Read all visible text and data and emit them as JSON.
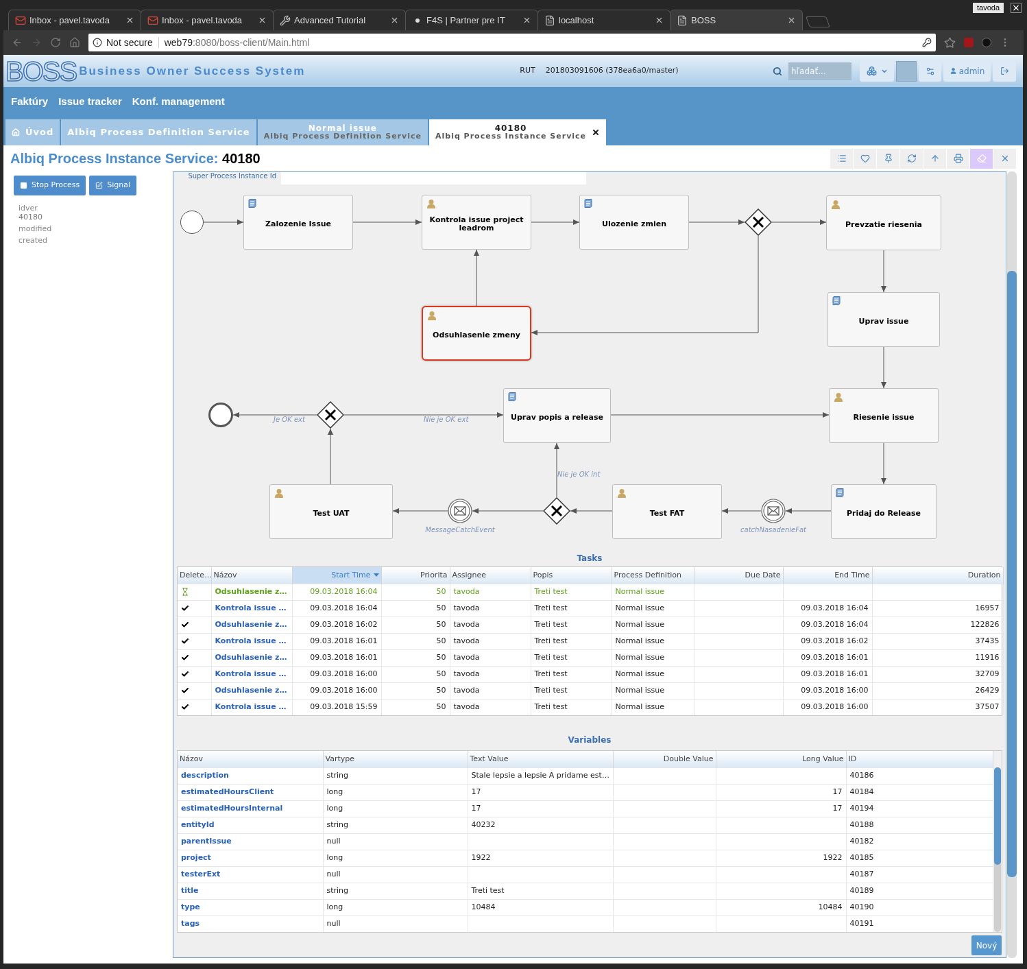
{
  "browser": {
    "tabs": [
      {
        "title": "Inbox - pavel.tavoda",
        "kind": "mail",
        "selected": false
      },
      {
        "title": "Inbox - pavel.tavoda",
        "kind": "mail",
        "selected": false
      },
      {
        "title": "Advanced Tutorial",
        "kind": "tool",
        "selected": false
      },
      {
        "title": "F4S | Partner pre IT",
        "kind": "dot",
        "selected": false
      },
      {
        "title": "localhost",
        "kind": "page",
        "selected": false
      },
      {
        "title": "BOSS",
        "kind": "page",
        "selected": true
      }
    ],
    "profile": "tavoda",
    "security": "Not secure",
    "url_host": "web79",
    "url_rest": ":8080/boss-client/Main.html"
  },
  "app": {
    "logo": "BOSS",
    "system_name": "Business Owner Success System",
    "env": "RUT",
    "build": "201803091606 (378ea6a0/master)",
    "search_placeholder": "hľadať...",
    "user": "admin"
  },
  "menu": [
    "Faktúry",
    "Issue tracker",
    "Konf. management"
  ],
  "tabs": [
    {
      "title": "Úvod",
      "kind": "home",
      "selected": false,
      "closable": false
    },
    {
      "title": "Albiq Process Definition Service",
      "selected": false,
      "closable": false
    },
    {
      "title": "Normal issue",
      "subtitle": "Albiq Process Definition Service",
      "selected": false,
      "closable": false
    },
    {
      "title": "40180",
      "subtitle": "Albiq Process Instance Service",
      "selected": true,
      "closable": true
    }
  ],
  "page": {
    "title": "Albiq Process Instance Service:",
    "id": "40180"
  },
  "toolbar": [
    {
      "kind": "list",
      "selected": false
    },
    {
      "kind": "favorite",
      "selected": false
    },
    {
      "kind": "pin",
      "selected": false
    },
    {
      "kind": "refresh",
      "selected": false
    },
    {
      "kind": "up",
      "selected": false
    },
    {
      "kind": "print",
      "selected": false
    },
    {
      "kind": "eraser",
      "selected": true
    },
    {
      "kind": "close",
      "selected": false
    }
  ],
  "actions": [
    {
      "label": "Stop Process",
      "kind": "stop"
    },
    {
      "label": "Signal",
      "kind": "signal"
    }
  ],
  "properties": [
    {
      "label": "idver",
      "value": "40180"
    },
    {
      "label": "modified"
    },
    {
      "label": "created"
    }
  ],
  "diagram": {
    "super_label": "Super Process Instance Id",
    "nodes": [
      {
        "kind": "start"
      },
      {
        "kind": "script_task",
        "label": "Zalozenie Issue",
        "active": false
      },
      {
        "kind": "user_task",
        "label": "Kontrola issue project leadrom",
        "active": false
      },
      {
        "kind": "script_task",
        "label": "Ulozenie zmien",
        "active": false
      },
      {
        "kind": "gateway"
      },
      {
        "kind": "user_task",
        "label": "Prevzatie riesenia",
        "active": false
      },
      {
        "kind": "user_task",
        "label": "Odsuhlasenie zmeny",
        "active": true
      },
      {
        "kind": "script_task",
        "label": "Uprav issue",
        "active": false
      },
      {
        "kind": "user_task",
        "label": "Riesenie issue",
        "active": false
      },
      {
        "kind": "script_task",
        "label": "Uprav popis a release",
        "active": false
      },
      {
        "kind": "gateway"
      },
      {
        "kind": "end"
      },
      {
        "kind": "script_task",
        "label": "Pridaj do Release",
        "active": false
      },
      {
        "kind": "message_event",
        "label": "catchNasadenieFat"
      },
      {
        "kind": "user_task",
        "label": "Test FAT",
        "active": false
      },
      {
        "kind": "gateway"
      },
      {
        "kind": "message_event",
        "label": "MessageCatchEvent"
      },
      {
        "kind": "user_task",
        "label": "Test UAT",
        "active": false
      }
    ],
    "flow_labels": [
      "Je OK ext",
      "Nie je OK ext",
      "Nie je OK int"
    ]
  },
  "tasks": {
    "title": "Tasks",
    "columns": [
      {
        "label": "Delete...",
        "sorted": false
      },
      {
        "label": "Názov",
        "sorted": false
      },
      {
        "label": "Start Time",
        "sorted": true
      },
      {
        "label": "Priorita",
        "sorted": false
      },
      {
        "label": "Assignee",
        "sorted": false
      },
      {
        "label": "Popis",
        "sorted": false
      },
      {
        "label": "Process Definition",
        "sorted": false
      },
      {
        "label": "Due Date",
        "sorted": false
      },
      {
        "label": "End Time",
        "sorted": false
      },
      {
        "label": "Duration",
        "sorted": false
      }
    ],
    "rows": [
      {
        "kind": "active",
        "name": "Odsuhlasenie z…",
        "start": "09.03.2018 16:04",
        "priority": "50",
        "assignee": "tavoda",
        "description": "Treti test",
        "definition": "Normal issue"
      },
      {
        "kind": "done",
        "name": "Kontrola issue …",
        "start": "09.03.2018 16:04",
        "priority": "50",
        "assignee": "tavoda",
        "description": "Treti test",
        "definition": "Normal issue",
        "end": "09.03.2018 16:04",
        "duration": "16957"
      },
      {
        "kind": "done",
        "name": "Odsuhlasenie z…",
        "start": "09.03.2018 16:02",
        "priority": "50",
        "assignee": "tavoda",
        "description": "Treti test",
        "definition": "Normal issue",
        "end": "09.03.2018 16:04",
        "duration": "122826"
      },
      {
        "kind": "done",
        "name": "Kontrola issue …",
        "start": "09.03.2018 16:01",
        "priority": "50",
        "assignee": "tavoda",
        "description": "Treti test",
        "definition": "Normal issue",
        "end": "09.03.2018 16:02",
        "duration": "37435"
      },
      {
        "kind": "done",
        "name": "Odsuhlasenie z…",
        "start": "09.03.2018 16:01",
        "priority": "50",
        "assignee": "tavoda",
        "description": "Treti test",
        "definition": "Normal issue",
        "end": "09.03.2018 16:01",
        "duration": "11916"
      },
      {
        "kind": "done",
        "name": "Kontrola issue …",
        "start": "09.03.2018 16:00",
        "priority": "50",
        "assignee": "tavoda",
        "description": "Treti test",
        "definition": "Normal issue",
        "end": "09.03.2018 16:01",
        "duration": "32709"
      },
      {
        "kind": "done",
        "name": "Odsuhlasenie z…",
        "start": "09.03.2018 16:00",
        "priority": "50",
        "assignee": "tavoda",
        "description": "Treti test",
        "definition": "Normal issue",
        "end": "09.03.2018 16:00",
        "duration": "26429"
      },
      {
        "kind": "done",
        "name": "Kontrola issue …",
        "start": "09.03.2018 15:59",
        "priority": "50",
        "assignee": "tavoda",
        "description": "Treti test",
        "definition": "Normal issue",
        "end": "09.03.2018 16:00",
        "duration": "37507"
      }
    ]
  },
  "variables": {
    "title": "Variables",
    "columns": [
      "Názov",
      "Vartype",
      "Text Value",
      "Double Value",
      "Long Value",
      "ID"
    ],
    "rows": [
      {
        "name": "description",
        "type": "string",
        "text": "Stale lepsie a lepsie A pridame est…",
        "id": "40186"
      },
      {
        "name": "estimatedHoursClient",
        "type": "long",
        "text": "17",
        "long": "17",
        "id": "40184"
      },
      {
        "name": "estimatedHoursInternal",
        "type": "long",
        "text": "17",
        "long": "17",
        "id": "40194"
      },
      {
        "name": "entityId",
        "type": "string",
        "text": "40232",
        "id": "40188"
      },
      {
        "name": "parentIssue",
        "type": "null",
        "id": "40182"
      },
      {
        "name": "project",
        "type": "long",
        "text": "1922",
        "long": "1922",
        "id": "40185"
      },
      {
        "name": "testerExt",
        "type": "null",
        "id": "40187"
      },
      {
        "name": "title",
        "type": "string",
        "text": "Treti test",
        "id": "40189"
      },
      {
        "name": "type",
        "type": "long",
        "text": "10484",
        "long": "10484",
        "id": "40190"
      },
      {
        "name": "tags",
        "type": "null",
        "id": "40191"
      }
    ],
    "button": "Nový"
  }
}
